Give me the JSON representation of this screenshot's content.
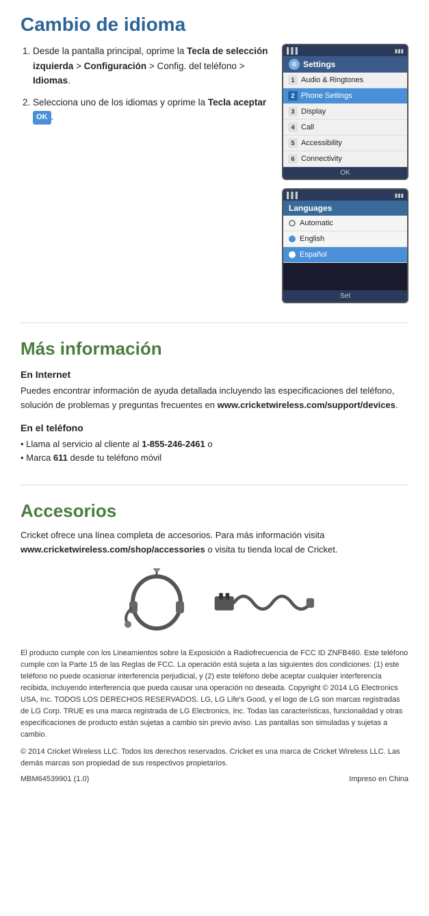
{
  "page": {
    "section1": {
      "title": "Cambio de idioma",
      "step1_text": "Desde la pantalla principal, oprime la ",
      "step1_bold1": "Tecla de selección izquierda",
      "step1_sep1": " > ",
      "step1_bold2": "Configuración",
      "step1_sep2": " > Config. del teléfono > ",
      "step1_bold3": "Idiomas",
      "step1_end": ".",
      "step2_text": "Selecciona uno de los idiomas y oprime la ",
      "step2_bold": "Tecla aceptar",
      "step2_ok": "OK",
      "step2_end": "."
    },
    "settings_screen": {
      "title": "Settings",
      "items": [
        {
          "num": "1",
          "label": "Audio & Ringtones",
          "selected": false
        },
        {
          "num": "2",
          "label": "Phone Settings",
          "selected": true
        },
        {
          "num": "3",
          "label": "Display",
          "selected": false
        },
        {
          "num": "4",
          "label": "Call",
          "selected": false
        },
        {
          "num": "5",
          "label": "Accessibility",
          "selected": false
        },
        {
          "num": "6",
          "label": "Connectivity",
          "selected": false
        }
      ],
      "footer": "OK"
    },
    "languages_screen": {
      "title": "Languages",
      "items": [
        {
          "label": "Automatic",
          "selected": false,
          "filled": false
        },
        {
          "label": "English",
          "selected": false,
          "filled": true
        },
        {
          "label": "Español",
          "selected": true,
          "filled": true
        }
      ],
      "footer": "Set"
    },
    "section2": {
      "title": "Más información",
      "internet_title": "En Internet",
      "internet_text": "Puedes encontrar información de ayuda detallada incluyendo las especificaciones del teléfono, solución de problemas y preguntas frecuentes en ",
      "internet_link": "www.cricketwireless.com/support/devices",
      "internet_end": ".",
      "phone_title": "En el teléfono",
      "phone_line1_pre": "• Llama al servicio al cliente al ",
      "phone_line1_bold": "1-855-246-2461",
      "phone_line1_end": " o",
      "phone_line2_pre": "• Marca ",
      "phone_line2_bold": "611",
      "phone_line2_end": " desde tu teléfono móvil"
    },
    "section3": {
      "title": "Accesorios",
      "text_pre": "Cricket ofrece una línea completa de accesorios. Para más información visita ",
      "text_link": "www.cricketwireless.com/shop/accessories",
      "text_end": " o visita tu tienda local de Cricket."
    },
    "fine_print": "El producto cumple con los Lineamientos sobre la Exposición a Radiofrecuencia de FCC ID ZNFB460. Este teléfono cumple con la Parte 15 de las Reglas de FCC. La operación está sujeta a las siguientes dos condiciones: (1) este teléfono no puede ocasionar interferencia perjudicial, y (2) este teléfono debe aceptar cualquier interferencia recibida, incluyendo interferencia que pueda causar una operación no deseada. Copyright © 2014 LG Electronics USA, Inc. TODOS LOS DERECHOS RESERVADOS. LG, LG Life's Good, y el logo de LG son marcas registradas de LG Corp. TRUE es una marca registrada de LG Electronics, Inc. Todas las características, funcionalidad y otras especificaciones de producto están sujetas a cambio sin previo aviso. Las pantallas son simuladas y sujetas a cambio.",
    "copyright": "© 2014 Cricket Wireless LLC. Todos los derechos reservados. Cricket es una marca de Cricket Wireless LLC. Las demás marcas son propiedad de sus respectivos propietarios.",
    "footer_left": "MBM64539901 (1.0)",
    "footer_right": "Impreso en China"
  }
}
